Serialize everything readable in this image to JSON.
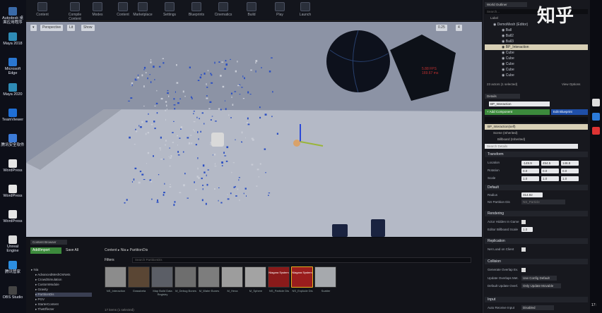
{
  "desktop": {
    "icons": [
      {
        "label": "Autodesk 桌面应用程序",
        "color": "#3a6aa8"
      },
      {
        "label": "Maya 2018",
        "color": "#2e8bb5"
      },
      {
        "label": "Microsoft Edge",
        "color": "#2a77d1"
      },
      {
        "label": "Maya 2020",
        "color": "#2e8bb5"
      },
      {
        "label": "TeamViewer",
        "color": "#1f6fd6"
      },
      {
        "label": "腾讯安全软件",
        "color": "#3c7bd8"
      },
      {
        "label": "WordPress",
        "color": "#e6e6e6"
      },
      {
        "label": "WordPress",
        "color": "#e6e6e6"
      },
      {
        "label": "WordPress",
        "color": "#e6e6e6"
      },
      {
        "label": "Unreal Engine",
        "color": "#dcdcdc"
      },
      {
        "label": "腾讯管家",
        "color": "#2c8ee0"
      },
      {
        "label": "OBS Studio",
        "color": "#444"
      }
    ]
  },
  "toolbar": {
    "buttons": [
      {
        "label": "Content"
      },
      {
        "label": "Compile Content"
      },
      {
        "label": "Modes"
      },
      {
        "label": "Content"
      },
      {
        "label": "Marketplace"
      },
      {
        "label": "Settings"
      },
      {
        "label": "Blueprints"
      },
      {
        "label": "Cinematics"
      },
      {
        "label": "Build"
      },
      {
        "label": "Play"
      },
      {
        "label": "Launch"
      }
    ]
  },
  "viewport": {
    "perspective_label": "Perspective",
    "lit_label": "Lit",
    "show_label": "Show",
    "snap_value": "0.25",
    "camera_speed": "4",
    "stat_text": "5.88 FPS\n169.67 ms",
    "sky_color": "#8c93a5",
    "floor_color": "#b4b9c6",
    "particle_color": "#2b4fc2"
  },
  "content_browser": {
    "tab_label": "Content Browser",
    "add_new_label": "Add/Import",
    "save_all_label": "Save All",
    "breadcrumb": [
      "Content",
      "Nia",
      "PartitionDis"
    ],
    "filters_label": "Filters",
    "search_placeholder": "Search PartitionDis",
    "footer_text": "17 items (1 selected)",
    "folders": [
      "Nia",
      "AdvancedMeshOnNets",
      "CrowdSimulation",
      "CustomModule",
      "Gravity",
      "PartitionDis",
      "PGV",
      "StarterContent",
      "TheEffecter"
    ],
    "assets": [
      {
        "name": "NS_Interaction",
        "color": "#8c8c8c"
      },
      {
        "name": "Grassbeta",
        "color": "#5a4634"
      },
      {
        "name": "Map Build Data Registry",
        "color": "#5b5e66"
      },
      {
        "name": "M_Debug Bones",
        "color": "#6e6e6e"
      },
      {
        "name": "M_Water Bones",
        "color": "#7d7d7d"
      },
      {
        "name": "M_Hexa",
        "color": "#9d9d9d"
      },
      {
        "name": "M_Sphere",
        "color": "#a3a3a3"
      },
      {
        "name": "NS_Particle Dis",
        "color": "#8a1a1a"
      },
      {
        "name": "NS_Explode Dis",
        "color": "#9a1d1d"
      },
      {
        "name": "Scatter",
        "color": "#a6a9ad"
      }
    ],
    "niagara_label": "Niagara System"
  },
  "outliner": {
    "tab_label": "World Outliner",
    "search_placeholder": "Search...",
    "col_label": "Label",
    "rows": [
      {
        "label": "DemoMesh (Editor)"
      },
      {
        "label": "Ball"
      },
      {
        "label": "Ball2"
      },
      {
        "label": "Ball3"
      },
      {
        "label": "BP_Interaction"
      },
      {
        "label": "Cube"
      },
      {
        "label": "Cube"
      },
      {
        "label": "Cube"
      },
      {
        "label": "Cube"
      },
      {
        "label": "Cube"
      }
    ],
    "footer": "23 actors (1 selected)",
    "view_options": "View Options"
  },
  "details": {
    "tab_label": "Details",
    "name_value": "BP_Interaction",
    "add_component_label": "+ Add Component",
    "edit_blueprint_label": "Edit Blueprint",
    "component_self": "BP_Interaction(self)",
    "component_scene": "Scene (Inherited)",
    "component_billboard": "Billboard (Inherited)",
    "search_placeholder": "Search Details",
    "sections": {
      "transform": "Transform",
      "default": "Default",
      "rendering": "Rendering",
      "replication": "Replication",
      "collision": "Collision",
      "input": "Input"
    },
    "location_label": "Location",
    "location": [
      "-149.9",
      "454.5",
      "146.8"
    ],
    "rotation_label": "Rotation",
    "rotation": [
      "0.0",
      "0.0",
      "0.0"
    ],
    "scale_label": "Scale",
    "scale": [
      "1.0",
      "1.0",
      "1.0"
    ],
    "radius_label": "Radius",
    "radius_value": "314.92",
    "ns_label": "NS Partition Dis",
    "ns_value": "NS_Particle",
    "hidden_label": "Actor Hidden In Game",
    "billboard_label": "Editor Billboard Scale",
    "billboard_value": "1.0",
    "net_label": "Net Load on Client",
    "gen_overlap_label": "Generate Overlap Ev.",
    "update_overlap_label": "Update Overlaps Met.",
    "update_overlap_value": "Use Config Default",
    "default_overlap_label": "Default Update Overl.",
    "default_overlap_value": "Only Update Movable",
    "auto_receive_label": "Auto Receive Input",
    "auto_receive_value": "Disabled"
  },
  "taskbar": {
    "time": "17:"
  },
  "watermark": "知乎"
}
